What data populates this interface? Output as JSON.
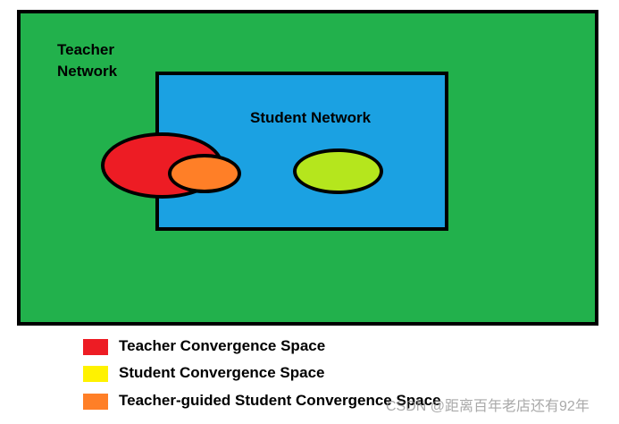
{
  "diagram": {
    "teacher_network": {
      "label_line1": "Teacher",
      "label_line2": "Network",
      "color": "#22b14c"
    },
    "student_network": {
      "label": "Student Network",
      "color": "#1ba1e2"
    },
    "regions": {
      "teacher_convergence": {
        "color": "#ed1c24"
      },
      "guided_convergence": {
        "color": "#ff7f27"
      },
      "student_convergence": {
        "color": "#b5e61d"
      }
    }
  },
  "legend": {
    "items": [
      {
        "label": "Teacher Convergence Space",
        "color": "#ed1c24"
      },
      {
        "label": "Student Convergence Space",
        "color": "#fff200"
      },
      {
        "label": "Teacher-guided Student Convergence Space",
        "color": "#ff7f27"
      }
    ]
  },
  "watermark": {
    "text": "CSDN @距离百年老店还有92年"
  }
}
